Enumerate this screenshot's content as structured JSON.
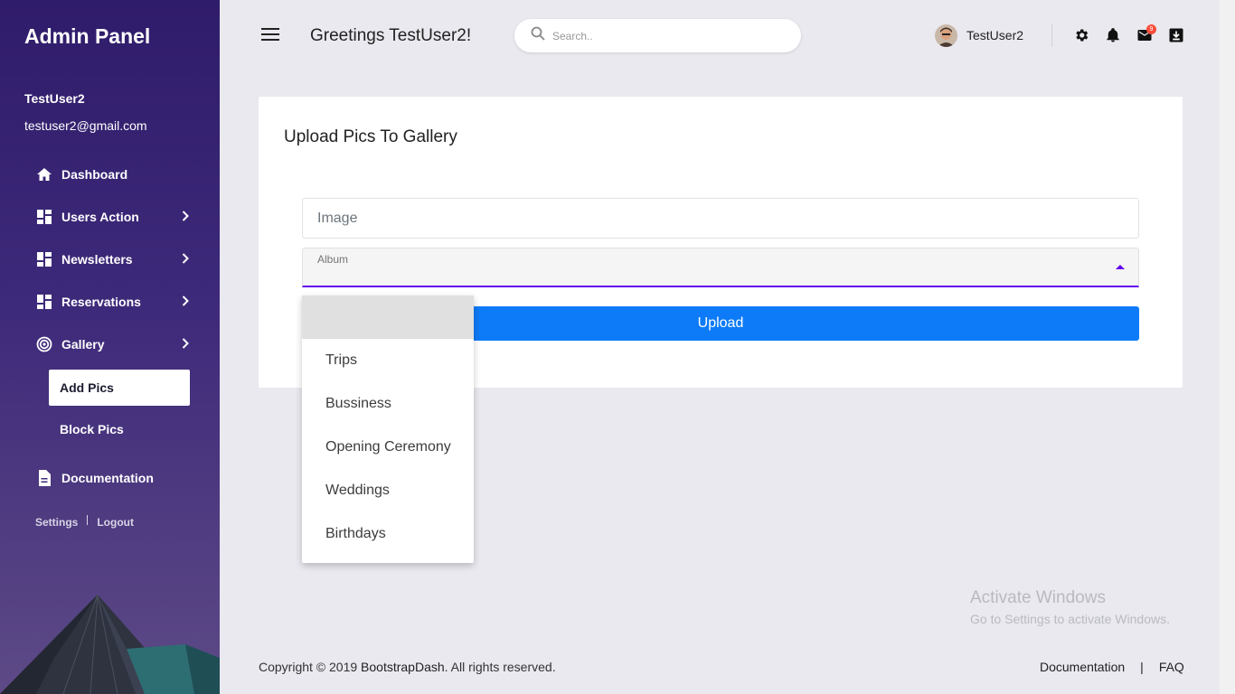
{
  "sidebar": {
    "brand": "Admin Panel",
    "user_name": "TestUser2",
    "user_email": "testuser2@gmail.com",
    "nav": [
      {
        "label": "Dashboard",
        "icon": "home-icon"
      },
      {
        "label": "Users Action",
        "icon": "grid-icon"
      },
      {
        "label": "Newsletters",
        "icon": "grid-icon"
      },
      {
        "label": "Reservations",
        "icon": "grid-icon"
      },
      {
        "label": "Gallery",
        "icon": "target-icon"
      }
    ],
    "gallery_sub": [
      "Add Pics",
      "Block Pics"
    ],
    "documentation": "Documentation",
    "settings": "Settings",
    "logout": "Logout"
  },
  "topbar": {
    "greeting": "Greetings TestUser2!",
    "search_placeholder": "Search..",
    "user": "TestUser2",
    "mail_badge": "9"
  },
  "card": {
    "title": "Upload Pics To Gallery",
    "image_placeholder": "Image",
    "album_label": "Album",
    "upload_label": "Upload"
  },
  "album_menu": {
    "options": [
      "",
      "Trips",
      "Bussiness",
      "Opening Ceremony",
      "Weddings",
      "Birthdays"
    ],
    "selected_index": 0
  },
  "footer": {
    "copyright_prefix": "Copyright © 2019 ",
    "copyright_link": "BootstrapDash",
    "copyright_suffix": ". All rights reserved.",
    "documentation": "Documentation",
    "separator": "|",
    "faq": "FAQ"
  },
  "watermark": {
    "line1": "Activate Windows",
    "line2": "Go to Settings to activate Windows."
  },
  "colors": {
    "sidebar_top": "#2f1c6a",
    "accent": "#6200ee",
    "button": "#0d7bf7",
    "badge": "#ff4d3a"
  }
}
